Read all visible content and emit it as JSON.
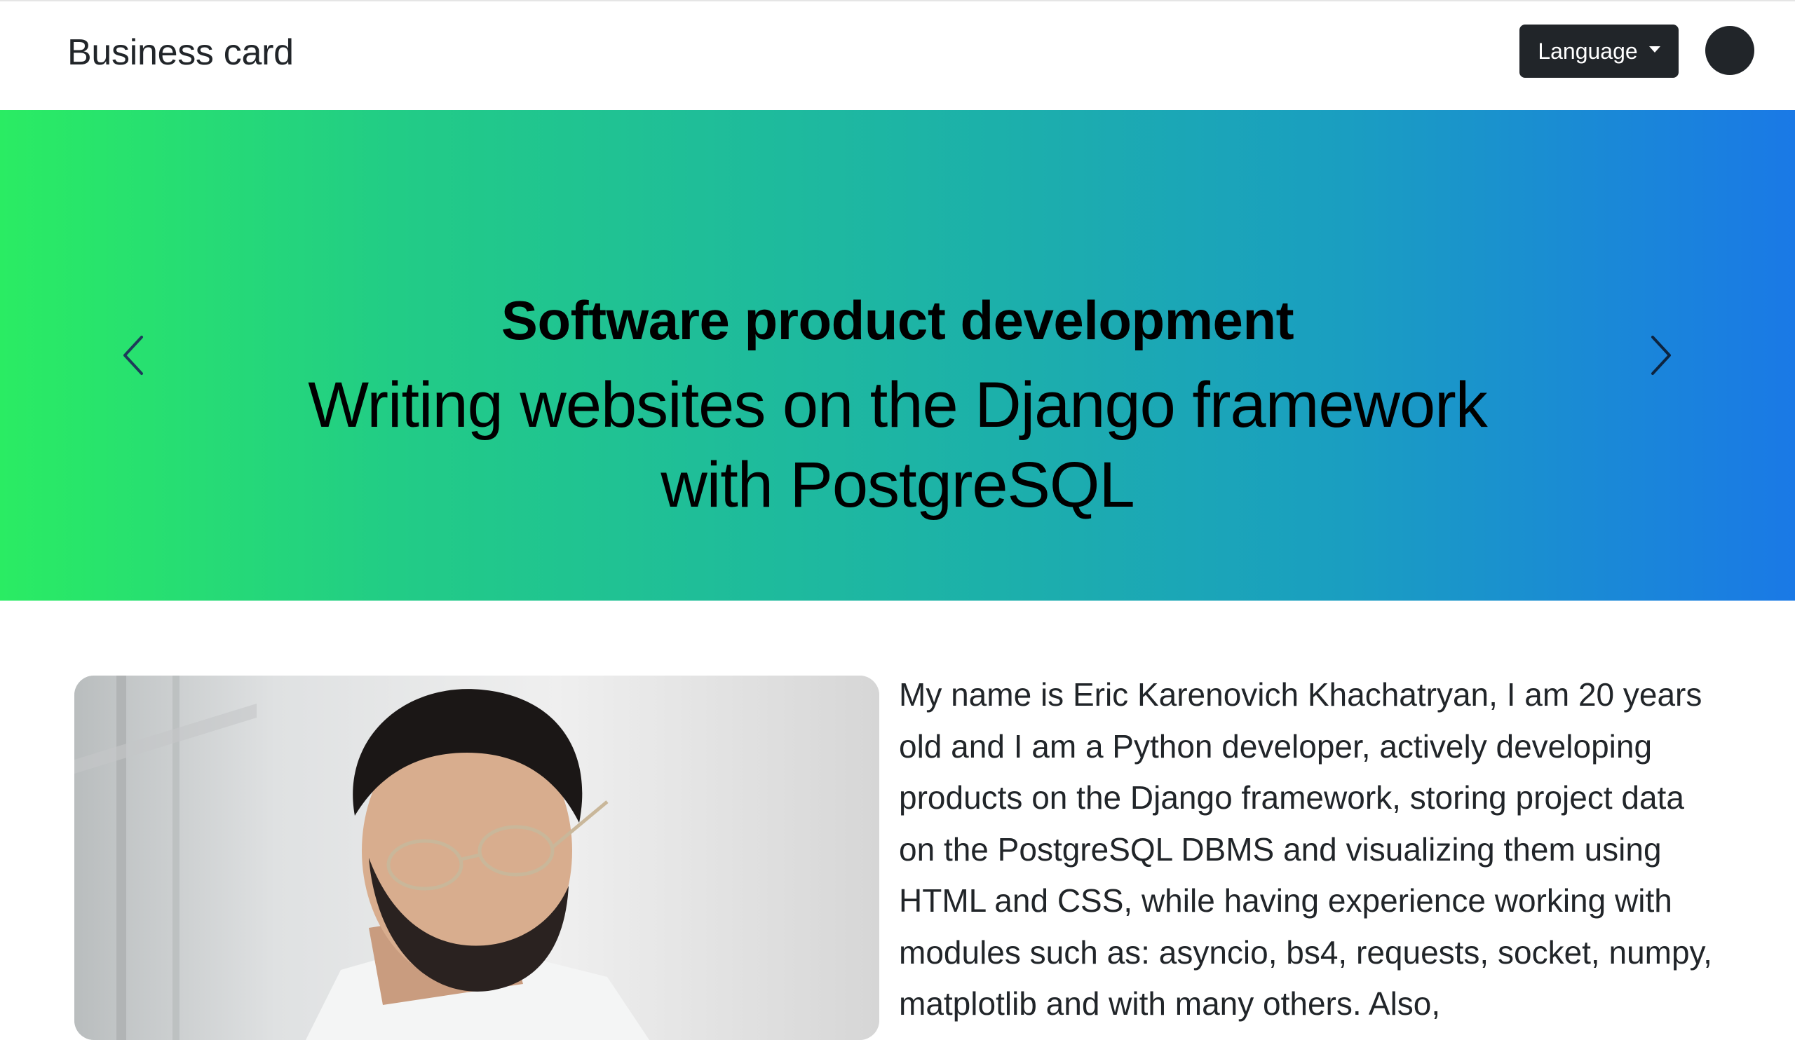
{
  "navbar": {
    "brand": "Business card",
    "language_label": "Language",
    "icons": {
      "dropdown": "caret-down-icon",
      "user": "user-avatar-icon"
    }
  },
  "carousel": {
    "active_slide": 1,
    "slide_count": 3,
    "slide": {
      "heading": "Software product development",
      "text": "Writing websites on the Django framework with PostgreSQL"
    },
    "colors": {
      "gradient_start": "#2aec63",
      "gradient_end": "#1a79e6"
    },
    "icons": {
      "prev": "chevron-left-icon",
      "next": "chevron-right-icon"
    }
  },
  "about": {
    "photo_alt": "Portrait photo",
    "text": "My name is Eric Karenovich Khachatryan, I am 20 years old and I am a Python developer, actively developing products on the Django framework, storing project data on the PostgreSQL DBMS and visualizing them using HTML and CSS, while having experience working with modules such as: asyncio, bs4, requests, socket, numpy, matplotlib and with many others. Also,"
  }
}
